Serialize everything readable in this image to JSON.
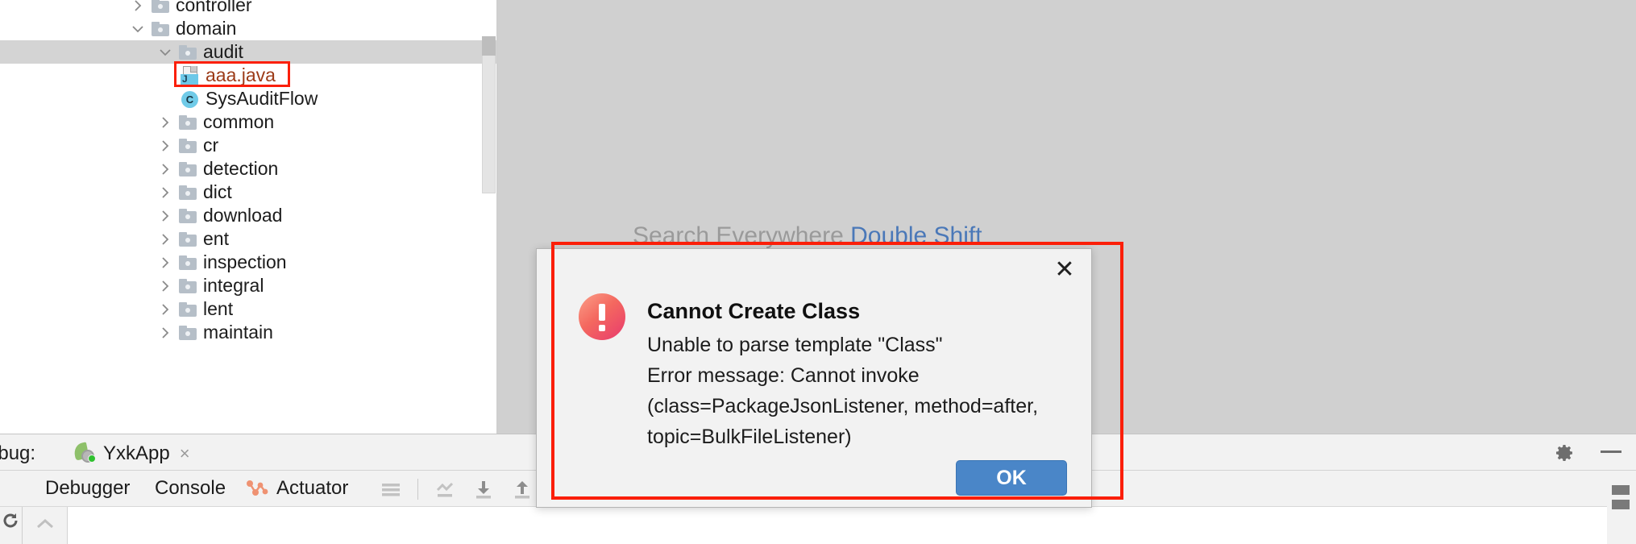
{
  "colors": {
    "annotation_red": "#fb1f09",
    "selection_gray": "#d4d4d4",
    "editor_backdrop": "#d0d0d0",
    "accent_blue": "#4a86c8",
    "tab_underline": "#9bb6d6",
    "hint_gray": "#9a9a9a",
    "hint_blue": "#4a78b8",
    "java_file_label": "#9c3b18"
  },
  "editor": {
    "hint_text": "Search Everywhere",
    "hint_shortcut": "Double Shift"
  },
  "project_tree": {
    "rows": [
      {
        "label": "controller",
        "icon": "folder-icon",
        "chevron": "chevron-right",
        "indent": 188,
        "selected": false
      },
      {
        "label": "domain",
        "icon": "folder-icon",
        "chevron": "chevron-down",
        "indent": 188,
        "selected": false
      },
      {
        "label": "audit",
        "icon": "folder-icon",
        "chevron": "chevron-down",
        "indent": 222,
        "selected": true
      },
      {
        "label": "aaa.java",
        "icon": "java-file-icon",
        "chevron": "none",
        "indent": 224,
        "selected": false
      },
      {
        "label": "SysAuditFlow",
        "icon": "java-class-icon",
        "chevron": "none",
        "indent": 224,
        "selected": false
      },
      {
        "label": "common",
        "icon": "folder-icon",
        "chevron": "chevron-right",
        "indent": 222,
        "selected": false
      },
      {
        "label": "cr",
        "icon": "folder-icon",
        "chevron": "chevron-right",
        "indent": 222,
        "selected": false
      },
      {
        "label": "detection",
        "icon": "folder-icon",
        "chevron": "chevron-right",
        "indent": 222,
        "selected": false
      },
      {
        "label": "dict",
        "icon": "folder-icon",
        "chevron": "chevron-right",
        "indent": 222,
        "selected": false
      },
      {
        "label": "download",
        "icon": "folder-icon",
        "chevron": "chevron-right",
        "indent": 222,
        "selected": false
      },
      {
        "label": "ent",
        "icon": "folder-icon",
        "chevron": "chevron-right",
        "indent": 222,
        "selected": false
      },
      {
        "label": "inspection",
        "icon": "folder-icon",
        "chevron": "chevron-right",
        "indent": 222,
        "selected": false
      },
      {
        "label": "integral",
        "icon": "folder-icon",
        "chevron": "chevron-right",
        "indent": 222,
        "selected": false
      },
      {
        "label": "lent",
        "icon": "folder-icon",
        "chevron": "chevron-right",
        "indent": 222,
        "selected": false
      },
      {
        "label": "maintain",
        "icon": "folder-icon",
        "chevron": "chevron-right",
        "indent": 222,
        "selected": false
      }
    ]
  },
  "dialog": {
    "title": "Cannot Create Class",
    "message_lines": [
      "Unable to parse template \"Class\"",
      "Error message: Cannot invoke",
      "(class=PackageJsonListener, method=after,",
      "topic=BulkFileListener)"
    ],
    "ok_label": "OK",
    "close_glyph": "✕",
    "icon": "error-exclamation-icon"
  },
  "debug_panel": {
    "header_label": "ebug:",
    "run_config_name": "YxkApp",
    "run_config_close_glyph": "×",
    "run_config_icon": "spring-boot-icon",
    "tabs": [
      {
        "label": "Debugger",
        "active": false,
        "icon": "none"
      },
      {
        "label": "Console",
        "active": true,
        "icon": "none"
      },
      {
        "label": "Actuator",
        "active": false,
        "icon": "actuator-icon"
      }
    ],
    "toolbar_icons": [
      "soft-wrap-icon",
      "separator",
      "scroll-to-end-icon",
      "export-down-icon",
      "import-up-icon"
    ],
    "settings_icon": "gear-icon",
    "minimize_icon": "minimize-icon",
    "left_strip_icons": [
      "resume-program-icon",
      "stop-icon",
      "rerun-icon"
    ]
  }
}
